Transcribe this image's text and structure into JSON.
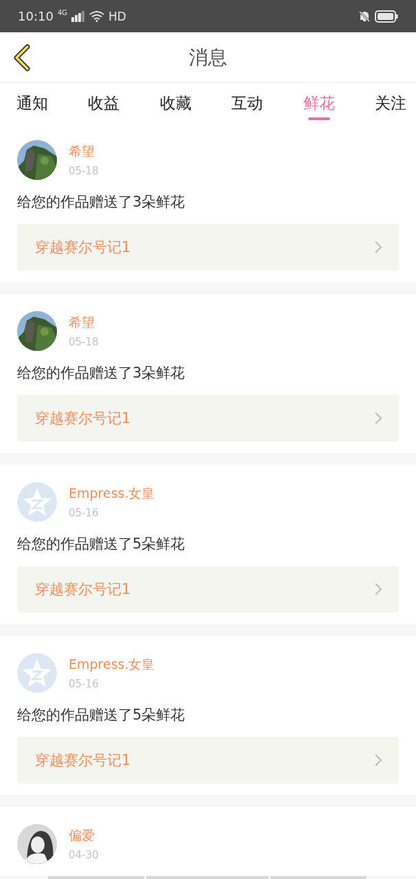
{
  "status_bar": {
    "time": "10:10",
    "network": "4G",
    "hd": "HD"
  },
  "header": {
    "title": "消息"
  },
  "tabs": [
    {
      "label": "通知",
      "selected": false
    },
    {
      "label": "收益",
      "selected": false
    },
    {
      "label": "收藏",
      "selected": false
    },
    {
      "label": "互动",
      "selected": false
    },
    {
      "label": "鲜花",
      "selected": true
    },
    {
      "label": "关注",
      "selected": false
    }
  ],
  "messages": [
    {
      "avatar": {
        "kind": "landscape"
      },
      "name": "希望",
      "date": "05-18",
      "text": "给您的作品赠送了3朵鲜花",
      "work": "穿越赛尔号记1"
    },
    {
      "avatar": {
        "kind": "landscape"
      },
      "name": "希望",
      "date": "05-18",
      "text": "给您的作品赠送了3朵鲜花",
      "work": "穿越赛尔号记1"
    },
    {
      "avatar": {
        "kind": "default"
      },
      "name": "Empress.女皇",
      "date": "05-16",
      "text": "给您的作品赠送了5朵鲜花",
      "work": "穿越赛尔号记1"
    },
    {
      "avatar": {
        "kind": "default"
      },
      "name": "Empress.女皇",
      "date": "05-16",
      "text": "给您的作品赠送了5朵鲜花",
      "work": "穿越赛尔号记1"
    },
    {
      "avatar": {
        "kind": "person"
      },
      "name": "偏爱",
      "date": "04-30"
    }
  ]
}
